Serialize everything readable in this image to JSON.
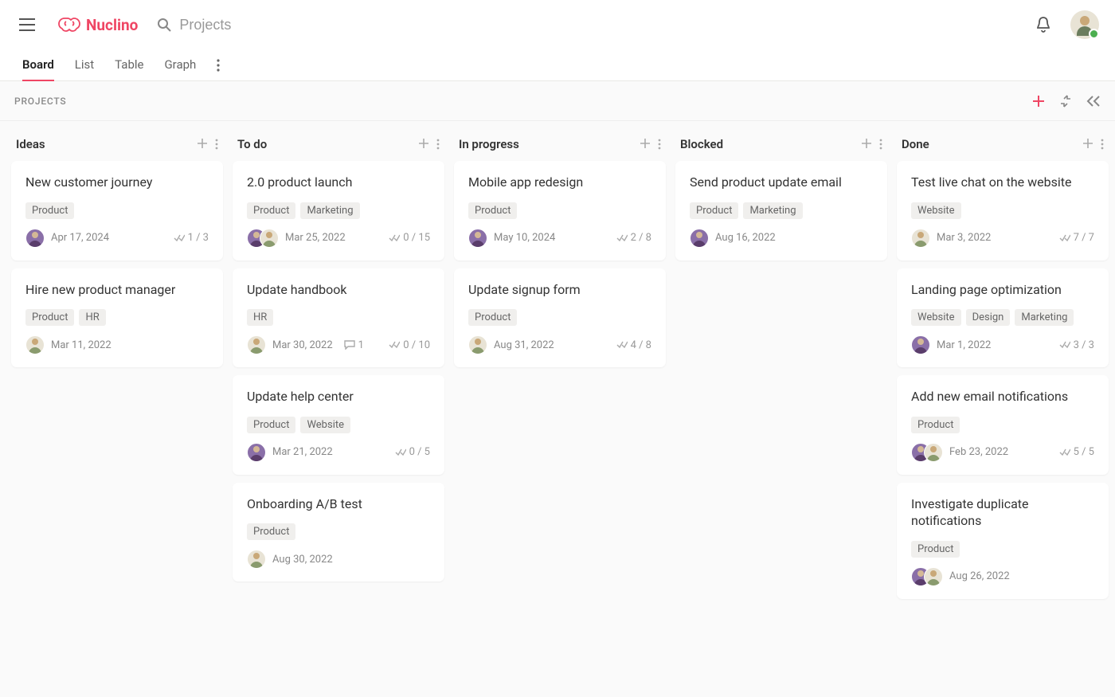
{
  "app": {
    "name": "Nuclino"
  },
  "search": {
    "placeholder": "Projects"
  },
  "tabs": {
    "board": "Board",
    "list": "List",
    "table": "Table",
    "graph": "Graph"
  },
  "subheader": {
    "title": "PROJECTS"
  },
  "columns": [
    {
      "title": "Ideas",
      "cards": [
        {
          "title": "New customer journey",
          "tags": [
            "Product"
          ],
          "assignees": [
            "av1"
          ],
          "date": "Apr 17, 2024",
          "progress": "1 / 3"
        },
        {
          "title": "Hire new product manager",
          "tags": [
            "Product",
            "HR"
          ],
          "assignees": [
            "av2"
          ],
          "date": "Mar 11, 2022"
        }
      ]
    },
    {
      "title": "To do",
      "cards": [
        {
          "title": "2.0 product launch",
          "tags": [
            "Product",
            "Marketing"
          ],
          "assignees": [
            "av1",
            "av2"
          ],
          "date": "Mar 25, 2022",
          "progress": "0 / 15"
        },
        {
          "title": "Update handbook",
          "tags": [
            "HR"
          ],
          "assignees": [
            "av2"
          ],
          "date": "Mar 30, 2022",
          "comments": "1",
          "progress": "0 / 10"
        },
        {
          "title": "Update help center",
          "tags": [
            "Product",
            "Website"
          ],
          "assignees": [
            "av1"
          ],
          "date": "Mar 21, 2022",
          "progress": "0 / 5"
        },
        {
          "title": "Onboarding A/B test",
          "tags": [
            "Product"
          ],
          "assignees": [
            "av2"
          ],
          "date": "Aug 30, 2022"
        }
      ]
    },
    {
      "title": "In progress",
      "cards": [
        {
          "title": "Mobile app redesign",
          "tags": [
            "Product"
          ],
          "assignees": [
            "av1"
          ],
          "date": "May 10, 2024",
          "progress": "2 / 8"
        },
        {
          "title": "Update signup form",
          "tags": [
            "Product"
          ],
          "assignees": [
            "av2"
          ],
          "date": "Aug 31, 2022",
          "progress": "4 / 8"
        }
      ]
    },
    {
      "title": "Blocked",
      "cards": [
        {
          "title": "Send product update email",
          "tags": [
            "Product",
            "Marketing"
          ],
          "assignees": [
            "av1"
          ],
          "date": "Aug 16, 2022"
        }
      ]
    },
    {
      "title": "Done",
      "cards": [
        {
          "title": "Test live chat on the website",
          "tags": [
            "Website"
          ],
          "assignees": [
            "av2"
          ],
          "date": "Mar 3, 2022",
          "progress": "7 / 7"
        },
        {
          "title": "Landing page optimization",
          "tags": [
            "Website",
            "Design",
            "Marketing"
          ],
          "assignees": [
            "av1"
          ],
          "date": "Mar 1, 2022",
          "progress": "3 / 3"
        },
        {
          "title": "Add new email notifications",
          "tags": [
            "Product"
          ],
          "assignees": [
            "av1",
            "av2"
          ],
          "date": "Feb 23, 2022",
          "progress": "5 / 5"
        },
        {
          "title": "Investigate duplicate notifications",
          "tags": [
            "Product"
          ],
          "assignees": [
            "av1",
            "av2"
          ],
          "date": "Aug 26, 2022"
        }
      ]
    }
  ]
}
